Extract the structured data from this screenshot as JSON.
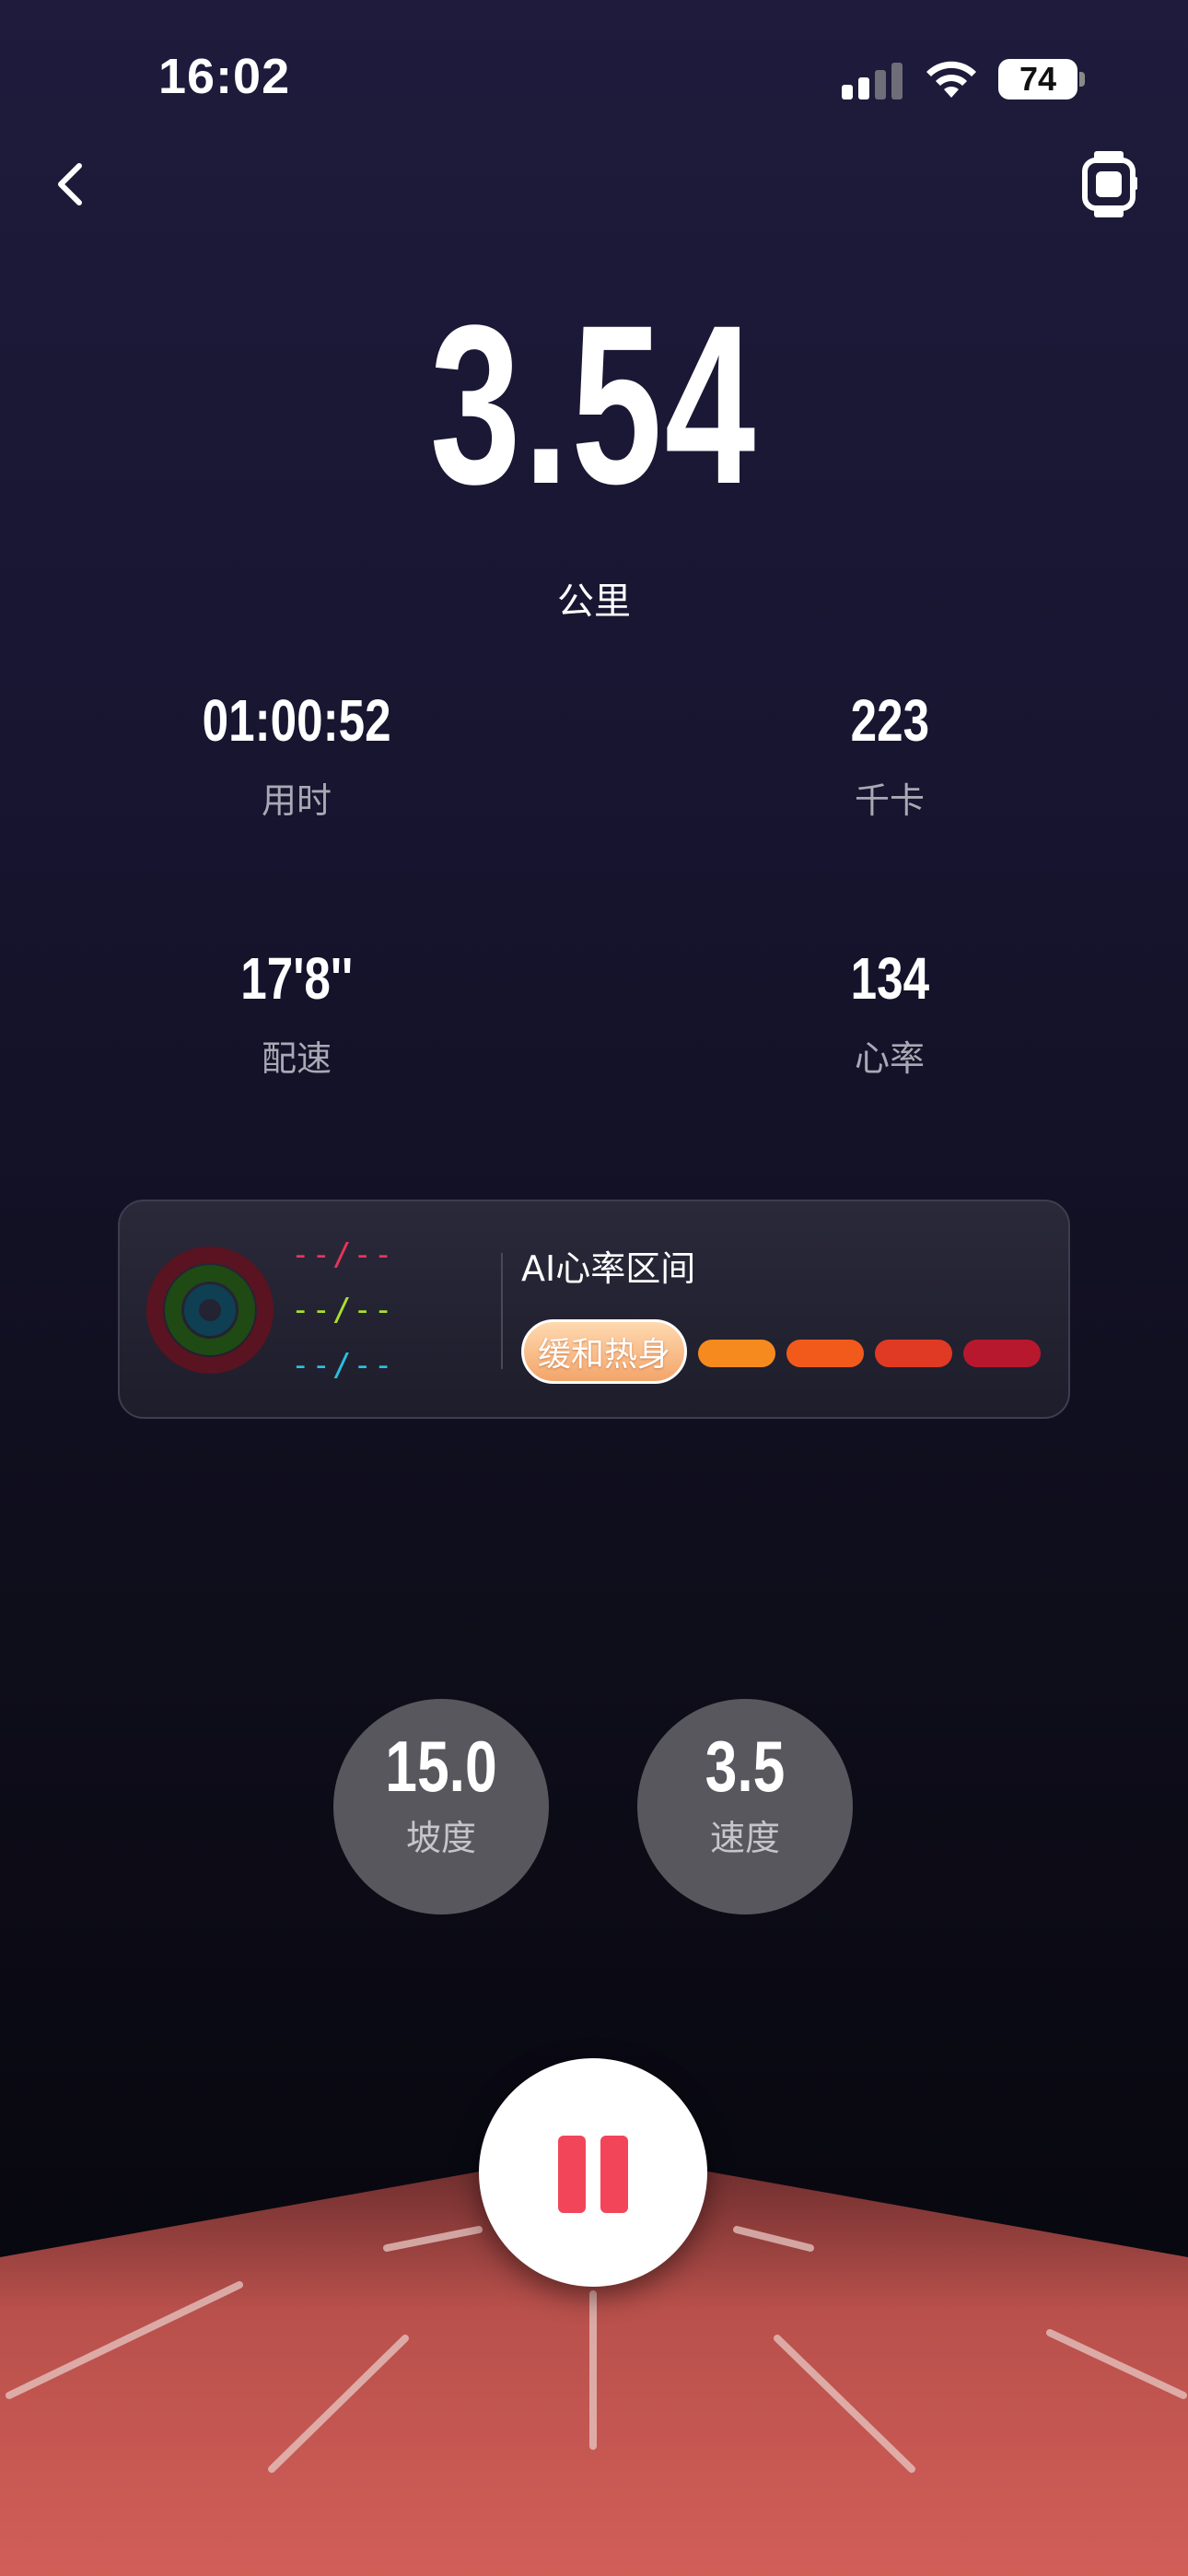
{
  "status_bar": {
    "time": "16:02",
    "battery": "74"
  },
  "run": {
    "distance": "3.54",
    "distance_unit": "公里",
    "stats": [
      {
        "value": "01:00:52",
        "label": "用时"
      },
      {
        "value": "223",
        "label": "千卡"
      },
      {
        "value": "17'8''",
        "label": "配速"
      },
      {
        "value": "134",
        "label": "心率"
      }
    ]
  },
  "heart_rate_card": {
    "ring_values": [
      {
        "text": "--/--",
        "color": "#e8345c"
      },
      {
        "text": "--/--",
        "color": "#a8e030"
      },
      {
        "text": "--/--",
        "color": "#2bbfe0"
      }
    ],
    "title": "AI心率区间",
    "active_zone": "缓和热身",
    "zone_colors": [
      "#f78a1e",
      "#f25a1c",
      "#e03a24",
      "#b8182e"
    ]
  },
  "controls": {
    "incline": {
      "value": "15.0",
      "label": "坡度"
    },
    "speed": {
      "value": "3.5",
      "label": "速度"
    }
  },
  "colors": {
    "accent": "#f2455a",
    "track": "#c44f4c"
  }
}
